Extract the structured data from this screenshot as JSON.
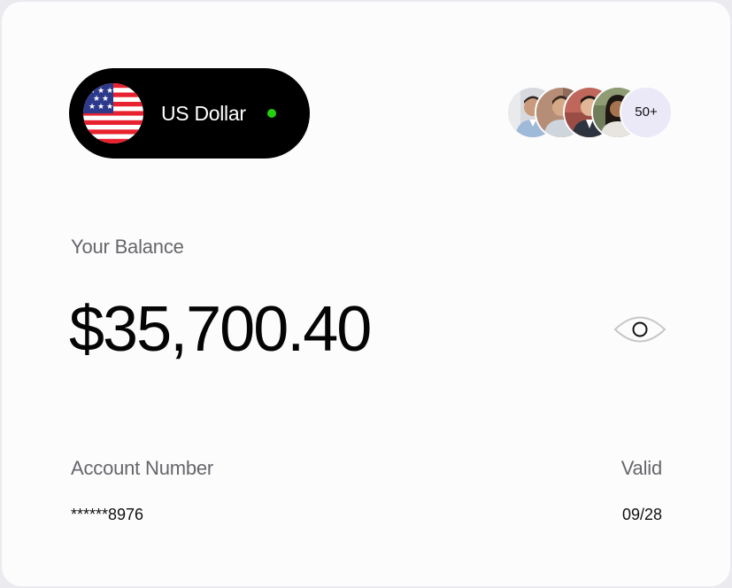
{
  "currency": {
    "label": "US Dollar",
    "flag_icon": "us-flag-icon",
    "status": "active",
    "status_color": "#22d00d",
    "pill_color": "#000000"
  },
  "members": {
    "avatars": [
      "avatar-1",
      "avatar-2",
      "avatar-3",
      "avatar-4"
    ],
    "count_label": "50+",
    "count_bg": "#ebe8f8"
  },
  "balance": {
    "label": "Your Balance",
    "amount": "$35,700.40",
    "toggle_icon": "eye-icon"
  },
  "account": {
    "number_label": "Account Number",
    "number_value": "******8976",
    "valid_label": "Valid",
    "valid_value": "09/28"
  },
  "colors": {
    "card_bg": "#fcfcfd",
    "page_bg": "#ebeaef",
    "muted_text": "#66666b",
    "primary_text": "#050505"
  }
}
